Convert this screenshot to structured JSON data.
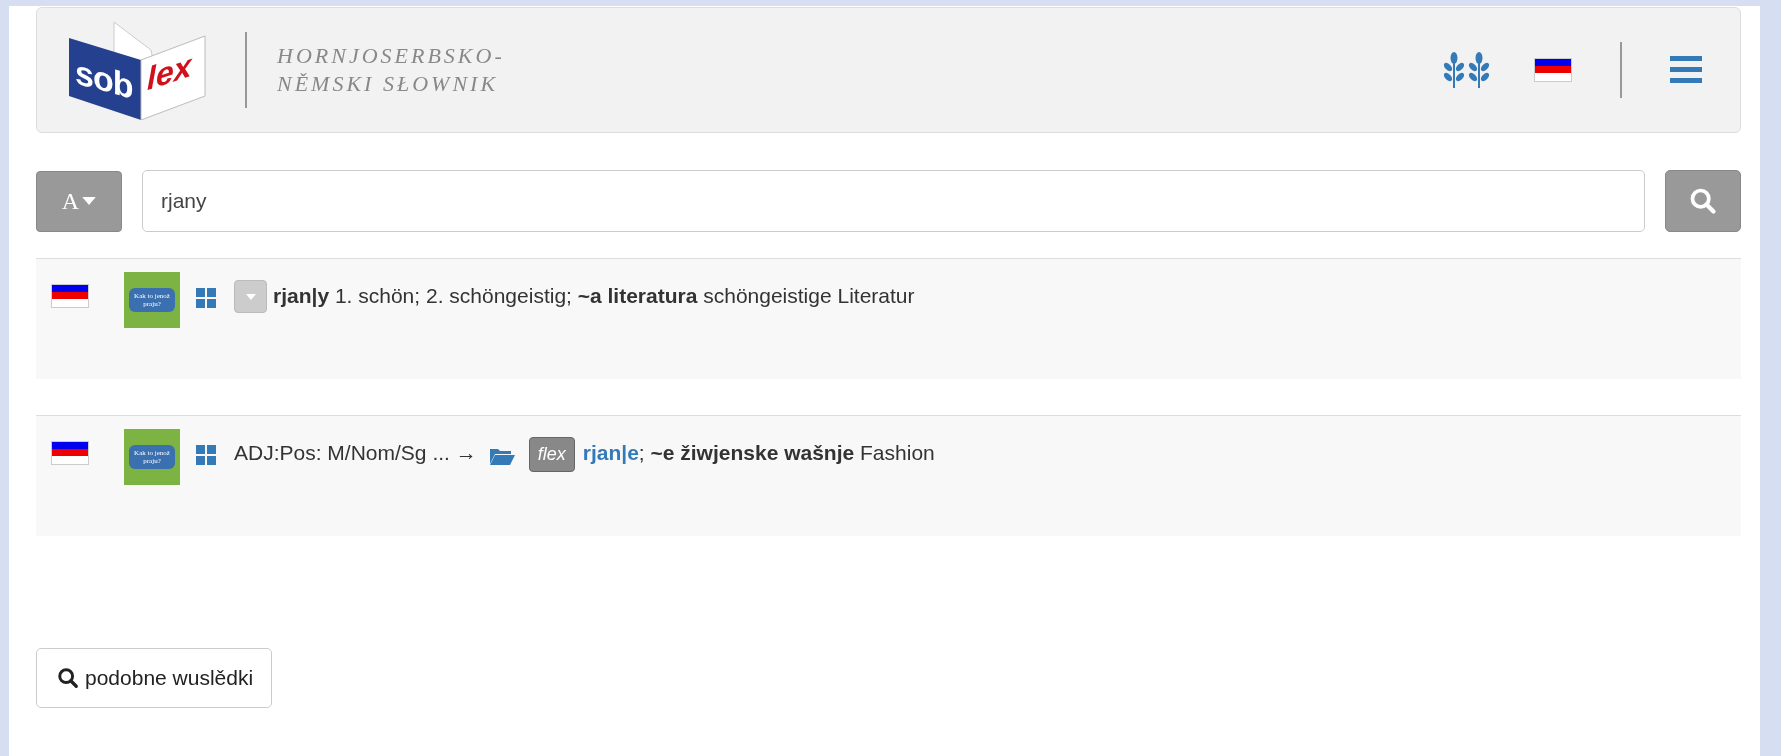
{
  "header": {
    "logo": {
      "left": "sob",
      "right": "lex"
    },
    "title_lines": [
      "HORNJOSERBSKO-",
      "NĚMSKI SŁOWNIK"
    ]
  },
  "search": {
    "alphabet_button": "A",
    "value": "rjany"
  },
  "results": [
    {
      "kind": "entry",
      "badge": "Kak to jenož praju?",
      "text": "**rjan|y** 1. schön; 2. schöngeistig; **~a literatura** schöngeistige Literatur"
    },
    {
      "kind": "inflection",
      "badge": "Kak to jenož praju?",
      "prefix": "ADJ:Pos: M/Nom/Sg ... →",
      "tag": "flex",
      "link": "rjan|e",
      "text": "; **~e žiwjenske wašnje** Fashion"
    }
  ],
  "similar_button": "podobne wuslědki"
}
